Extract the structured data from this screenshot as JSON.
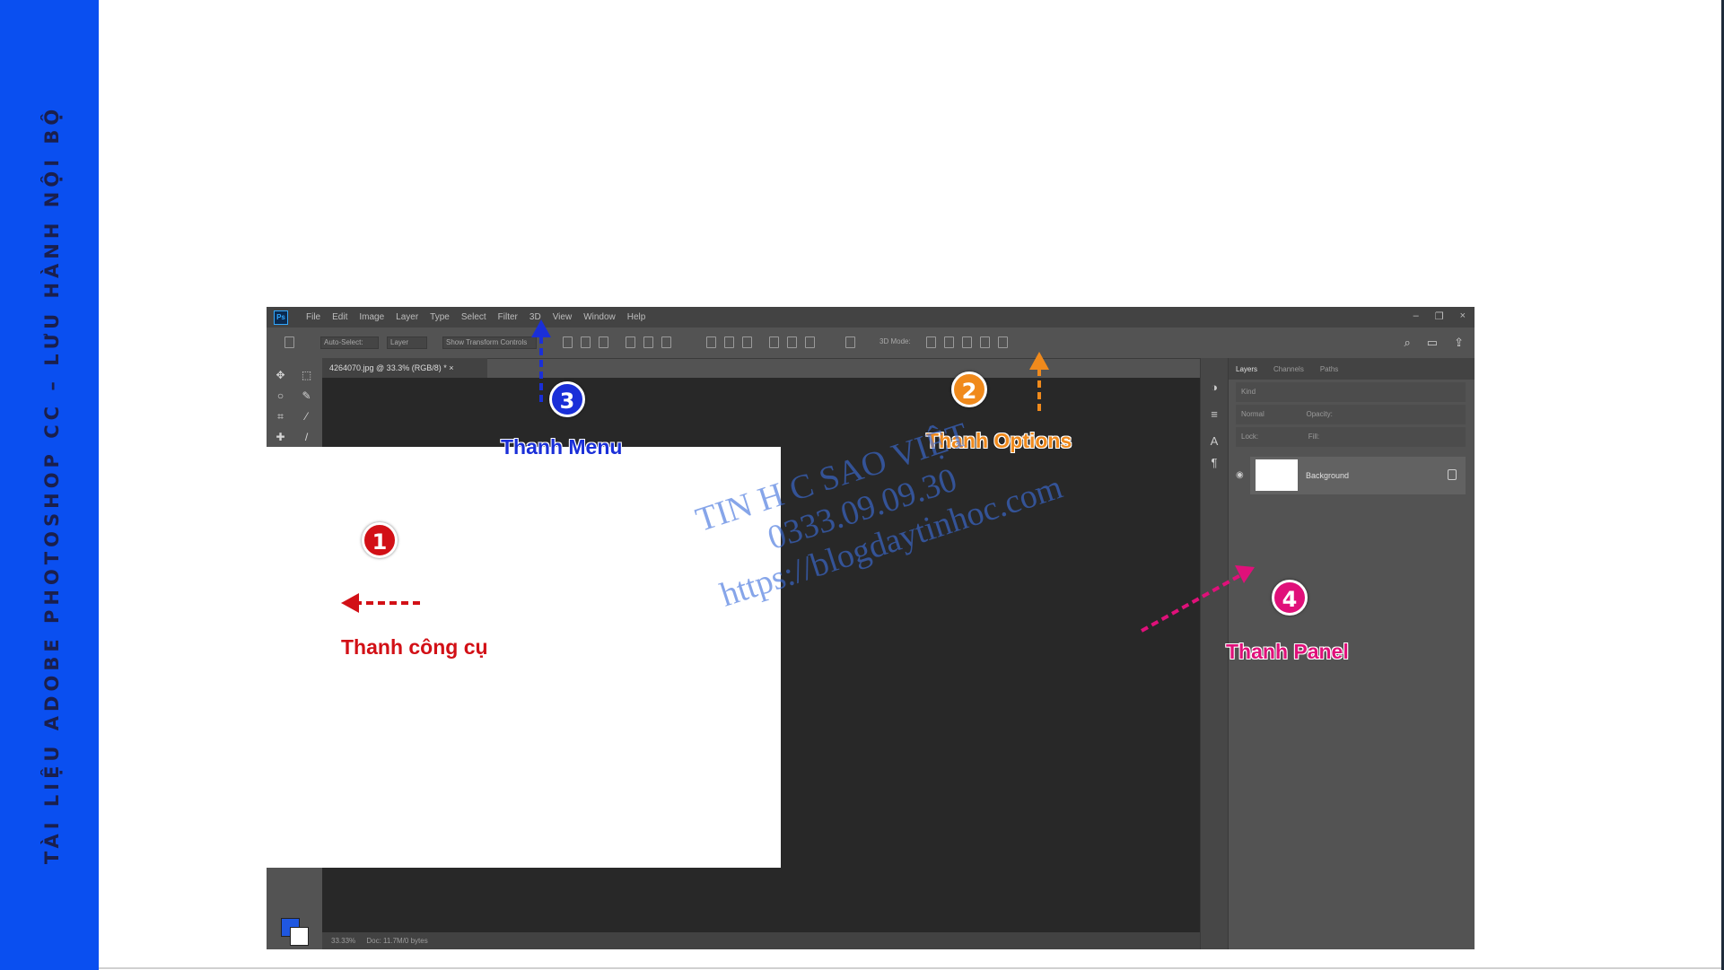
{
  "banner": {
    "text": "TÀI LIỆU ADOBE PHOTOSHOP CC – LƯU HÀNH NỘI BỘ",
    "color": "#0a4ff0"
  },
  "photoshop": {
    "logo": "Ps",
    "menu": [
      "File",
      "Edit",
      "Image",
      "Layer",
      "Type",
      "Select",
      "Filter",
      "3D",
      "View",
      "Window",
      "Help"
    ],
    "window_controls": [
      "–",
      "❐",
      "×"
    ],
    "options_bar": {
      "auto_select_label": "Auto-Select:",
      "auto_select_value": "Layer",
      "show_transform_label": "Show Transform Controls",
      "mode_3d_label": "3D Mode:"
    },
    "document_tab": "4264070.jpg @ 33.3% (RGB/8) * ×",
    "status_bar": {
      "zoom": "33.33%",
      "doc_size": "Doc: 11.7M/0 bytes"
    },
    "panels": {
      "tabs": [
        "Layers",
        "Channels",
        "Paths"
      ],
      "kind_label": "Kind",
      "blend_mode": "Normal",
      "opacity_label": "Opacity:",
      "lock_label": "Lock:",
      "fill_label": "Fill:",
      "layer_name": "Background"
    },
    "colors": {
      "foreground": "#1f57e0",
      "background": "#ffffff",
      "ui_dark": "#282828",
      "ui_mid": "#535353"
    }
  },
  "annotations": {
    "toolbar": {
      "number": "1",
      "label": "Thanh công cụ",
      "color": "#d21016"
    },
    "options": {
      "number": "2",
      "label": "Thanh Options",
      "color": "#f08a1c"
    },
    "menu": {
      "number": "3",
      "label": "Thanh Menu",
      "color": "#1a2fd8"
    },
    "panel": {
      "number": "4",
      "label": "Thanh Panel",
      "color": "#e0107a"
    }
  },
  "watermark": {
    "line1": "TIN H   C SAO VIỆT",
    "line2": "0333.09.09.30",
    "line3": "https://blogdaytinhoc.com"
  }
}
